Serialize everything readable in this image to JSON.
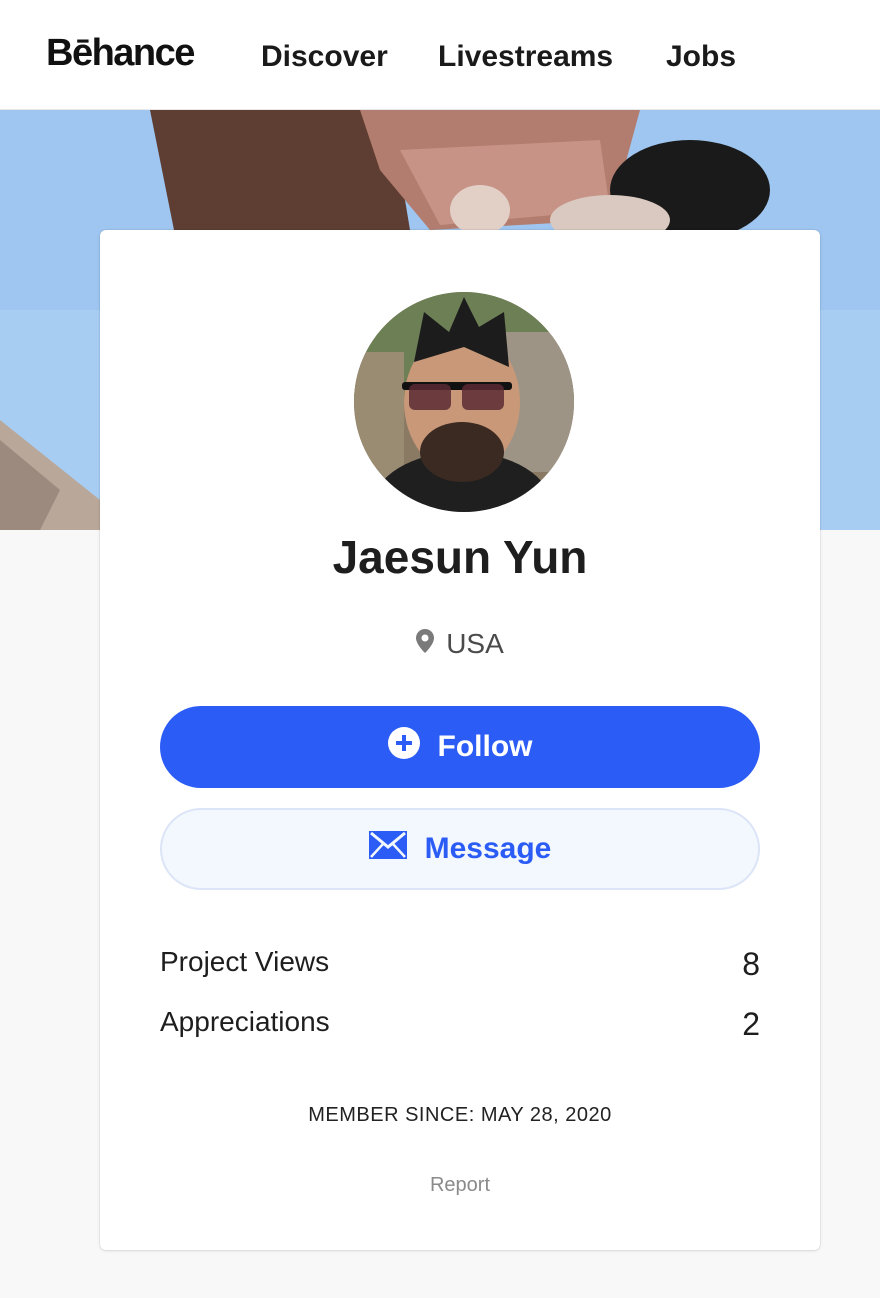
{
  "header": {
    "logo": "Bēhance",
    "nav": [
      "Discover",
      "Livestreams",
      "Jobs"
    ]
  },
  "profile": {
    "name": "Jaesun Yun",
    "location": "USA",
    "follow_label": "Follow",
    "message_label": "Message",
    "stats": [
      {
        "label": "Project Views",
        "value": "8"
      },
      {
        "label": "Appreciations",
        "value": "2"
      }
    ],
    "member_since": "MEMBER SINCE: MAY 28, 2020",
    "report_label": "Report"
  },
  "colors": {
    "accent": "#2b5cf5",
    "message_bg": "#f3f7fe",
    "page_bg": "#f8f8f8"
  },
  "icons": [
    "location-pin-icon",
    "plus-circle-icon",
    "envelope-icon"
  ]
}
